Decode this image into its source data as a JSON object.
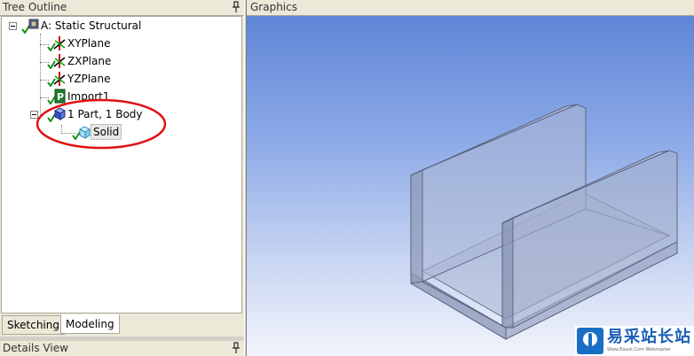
{
  "tree_outline": {
    "title": "Tree Outline",
    "items": [
      {
        "label": "A: Static Structural",
        "icon": "static-structural-icon"
      },
      {
        "label": "XYPlane",
        "icon": "plane-axes-icon"
      },
      {
        "label": "ZXPlane",
        "icon": "plane-axes-icon"
      },
      {
        "label": "YZPlane",
        "icon": "plane-axes-icon"
      },
      {
        "label": "Import1",
        "icon": "import-icon"
      },
      {
        "label": "1 Part, 1 Body",
        "icon": "part-icon"
      },
      {
        "label": "Solid",
        "icon": "solid-body-icon"
      }
    ]
  },
  "tabs": {
    "sketching": "Sketching",
    "modeling": "Modeling",
    "active": "Modeling"
  },
  "details_view": {
    "title": "Details View"
  },
  "graphics": {
    "title": "Graphics"
  },
  "watermark": {
    "text": "易采站长站",
    "subtext": "Www.Easck.Com Webmaster"
  },
  "colors": {
    "check": "#1a8f1a",
    "annotation": "#e01010",
    "viewport_top": "#5f85d6"
  }
}
